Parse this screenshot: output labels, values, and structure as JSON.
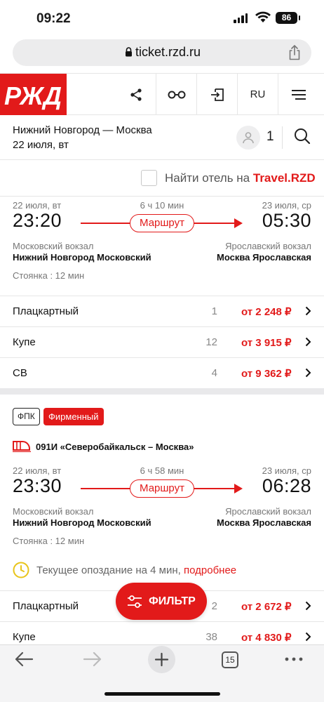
{
  "status": {
    "time": "09:22",
    "battery": "86"
  },
  "browser": {
    "url": "ticket.rzd.ru",
    "tab_count": "15"
  },
  "header": {
    "lang": "RU"
  },
  "search": {
    "route": "Нижний Новгород — Москва",
    "date": "22 июля, вт",
    "passengers": "1"
  },
  "hotel": {
    "prefix": "Найти отель на ",
    "brand": "Travel.RZD"
  },
  "trains": [
    {
      "dep_date": "22 июля, вт",
      "duration": "6 ч 10 мин",
      "arr_date": "23 июля, ср",
      "dep_time": "23:20",
      "arr_time": "05:30",
      "route_label": "Маршрут",
      "dep_station": "Московский вокзал",
      "dep_city": "Нижний Новгород Московский",
      "arr_station": "Ярославский вокзал",
      "arr_city": "Москва Ярославская",
      "stop": "Стоянка : 12 мин",
      "fares": [
        {
          "class": "Плацкартный",
          "seats": "1",
          "price": "от 2 248 ₽"
        },
        {
          "class": "Купе",
          "seats": "12",
          "price": "от 3 915 ₽"
        },
        {
          "class": "СВ",
          "seats": "4",
          "price": "от 9 362 ₽"
        }
      ]
    },
    {
      "badge_carrier": "ФПК",
      "badge_type": "Фирменный",
      "name": "091И «Северобайкальск – Москва»",
      "dep_date": "22 июля, вт",
      "duration": "6 ч 58 мин",
      "arr_date": "23 июля, ср",
      "dep_time": "23:30",
      "arr_time": "06:28",
      "route_label": "Маршрут",
      "dep_station": "Московский вокзал",
      "dep_city": "Нижний Новгород Московский",
      "arr_station": "Ярославский вокзал",
      "arr_city": "Москва Ярославская",
      "stop": "Стоянка : 12 мин",
      "delay_text": "Текущее опоздание на 4 мин, ",
      "delay_link": "подробнее",
      "fares": [
        {
          "class": "Плацкартный",
          "seats": "2",
          "price": "от 2 672 ₽"
        },
        {
          "class": "Купе",
          "seats": "38",
          "price": "от 4 830 ₽"
        }
      ]
    }
  ],
  "filter": {
    "label": "ФИЛЬТР"
  },
  "colors": {
    "brand": "#e21a1a"
  }
}
